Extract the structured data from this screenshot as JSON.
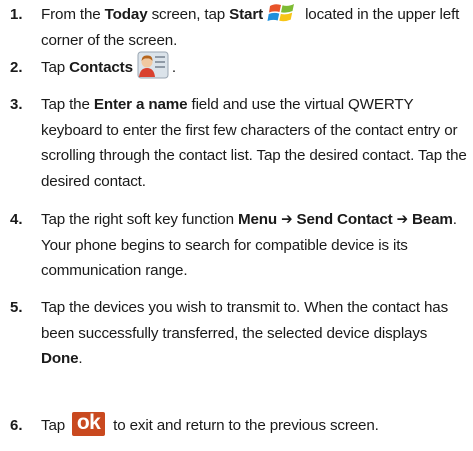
{
  "steps": [
    {
      "number": "1.",
      "parts": [
        {
          "t": "From the "
        },
        {
          "t": "Today",
          "b": true
        },
        {
          "t": " screen, tap "
        },
        {
          "t": "Start",
          "b": true
        },
        {
          "icon": "windows-start-icon"
        },
        {
          "t": " located in the upper left corner of the screen."
        }
      ]
    },
    {
      "number": "2.",
      "parts": [
        {
          "t": "Tap "
        },
        {
          "t": "Contacts",
          "b": true
        },
        {
          "icon": "contacts-icon"
        },
        {
          "t": "."
        }
      ]
    },
    {
      "number": "3.",
      "parts": [
        {
          "t": "Tap the "
        },
        {
          "t": "Enter a name",
          "b": true
        },
        {
          "t": " field and use the virtual QWERTY keyboard to enter the first few characters of the contact entry or scrolling through the contact list. Tap the desired contact. Tap the desired contact."
        }
      ]
    },
    {
      "number": "4.",
      "parts": [
        {
          "t": "Tap the right soft key function "
        },
        {
          "t": "Menu ➔ Send Contact ➔ Beam",
          "b": true
        },
        {
          "t": ". Your phone begins to search for compatible device is its communication range."
        }
      ]
    },
    {
      "number": "5.",
      "parts": [
        {
          "t": "Tap the devices you wish to transmit to. When the contact has been successfully transferred, the selected device displays "
        },
        {
          "t": "Done",
          "b": true
        },
        {
          "t": "."
        }
      ]
    },
    {
      "number": "6.",
      "parts": [
        {
          "t": "Tap "
        },
        {
          "icon": "ok-button-icon",
          "label": "ok"
        },
        {
          "t": " to exit and return to the previous screen."
        }
      ]
    }
  ]
}
